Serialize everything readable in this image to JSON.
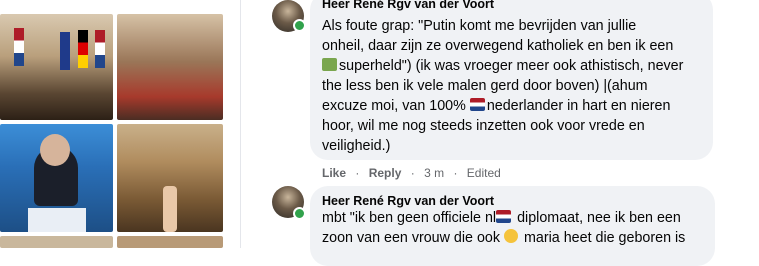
{
  "photos": [
    {
      "name": "photo-press-conference"
    },
    {
      "name": "photo-state-hall"
    },
    {
      "name": "photo-podium-speaker"
    },
    {
      "name": "photo-ornate-room"
    }
  ],
  "comments": [
    {
      "author": "Heer René Rgv van der Voort",
      "lines": [
        {
          "pre": "Als foute grap: \"Putin komt me bevrijden van jullie",
          "emoji": "",
          "post": ""
        },
        {
          "pre": "onheil, daar zijn ze overwegend katholiek en ben ik een",
          "emoji": "",
          "post": ""
        },
        {
          "pre": "",
          "emoji": "superhero-icon",
          "post": "superheld\") (ik was vroeger meer ook athistisch, never"
        },
        {
          "pre": "the less ben ik vele malen gerd door boven) |(ahum",
          "emoji": "",
          "post": ""
        },
        {
          "pre": "excuze moi, van 100% ",
          "emoji": "netherlands-flag-icon",
          "post": "nederlander in hart en nieren"
        },
        {
          "pre": "hoor, wil me nog steeds inzetten ook voor vrede en",
          "emoji": "",
          "post": ""
        },
        {
          "pre": "veiligheid.)",
          "emoji": "",
          "post": ""
        }
      ],
      "like": "Like",
      "reply": "Reply",
      "time": "3 m",
      "edited": "Edited"
    },
    {
      "author": "Heer René Rgv van der Voort",
      "lines": [
        {
          "pre": "mbt \"ik ben geen officiele nl",
          "emoji": "netherlands-flag-icon",
          "post": " diplomaat, nee ik ben een"
        },
        {
          "pre": "zoon van een vrouw die ook ",
          "emoji": "smiling-face-icon",
          "post": " maria heet die geboren is"
        }
      ]
    }
  ],
  "colors": {
    "bubble": "#f0f2f5",
    "online": "#31a24c",
    "meta": "#65676b"
  }
}
